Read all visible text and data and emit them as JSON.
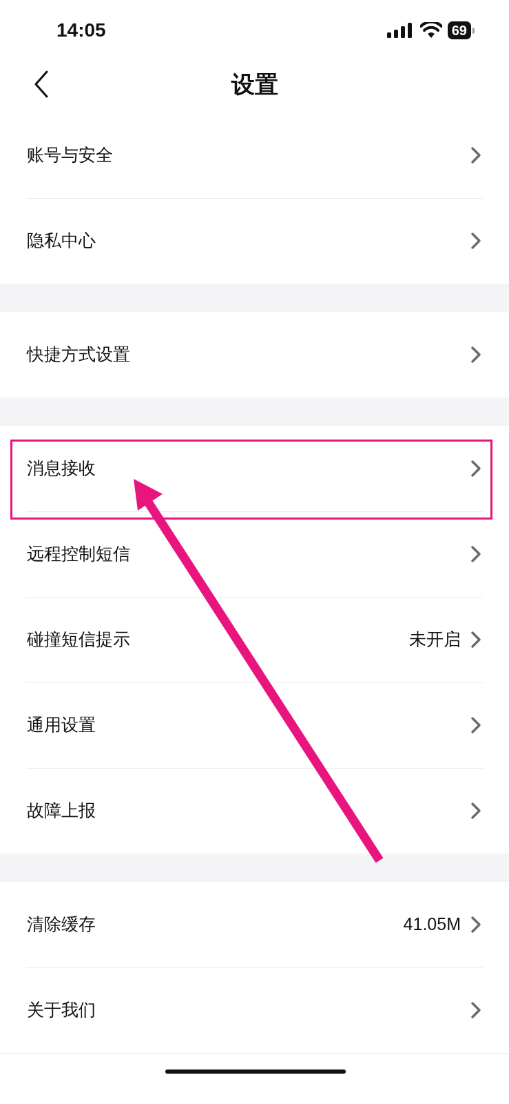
{
  "status_bar": {
    "time": "14:05",
    "battery": "69"
  },
  "nav": {
    "title": "设置"
  },
  "groups": [
    {
      "items": [
        {
          "label": "账号与安全",
          "highlighted": false
        },
        {
          "label": "隐私中心",
          "highlighted": false
        }
      ]
    },
    {
      "items": [
        {
          "label": "快捷方式设置",
          "highlighted": false
        }
      ]
    },
    {
      "items": [
        {
          "label": "消息接收",
          "highlighted": true
        },
        {
          "label": "远程控制短信",
          "highlighted": false
        },
        {
          "label": "碰撞短信提示",
          "value": "未开启",
          "highlighted": false
        },
        {
          "label": "通用设置",
          "highlighted": false
        },
        {
          "label": "故障上报",
          "highlighted": false
        }
      ]
    },
    {
      "items": [
        {
          "label": "清除缓存",
          "value": "41.05M",
          "highlighted": false
        },
        {
          "label": "关于我们",
          "highlighted": false
        }
      ]
    }
  ]
}
